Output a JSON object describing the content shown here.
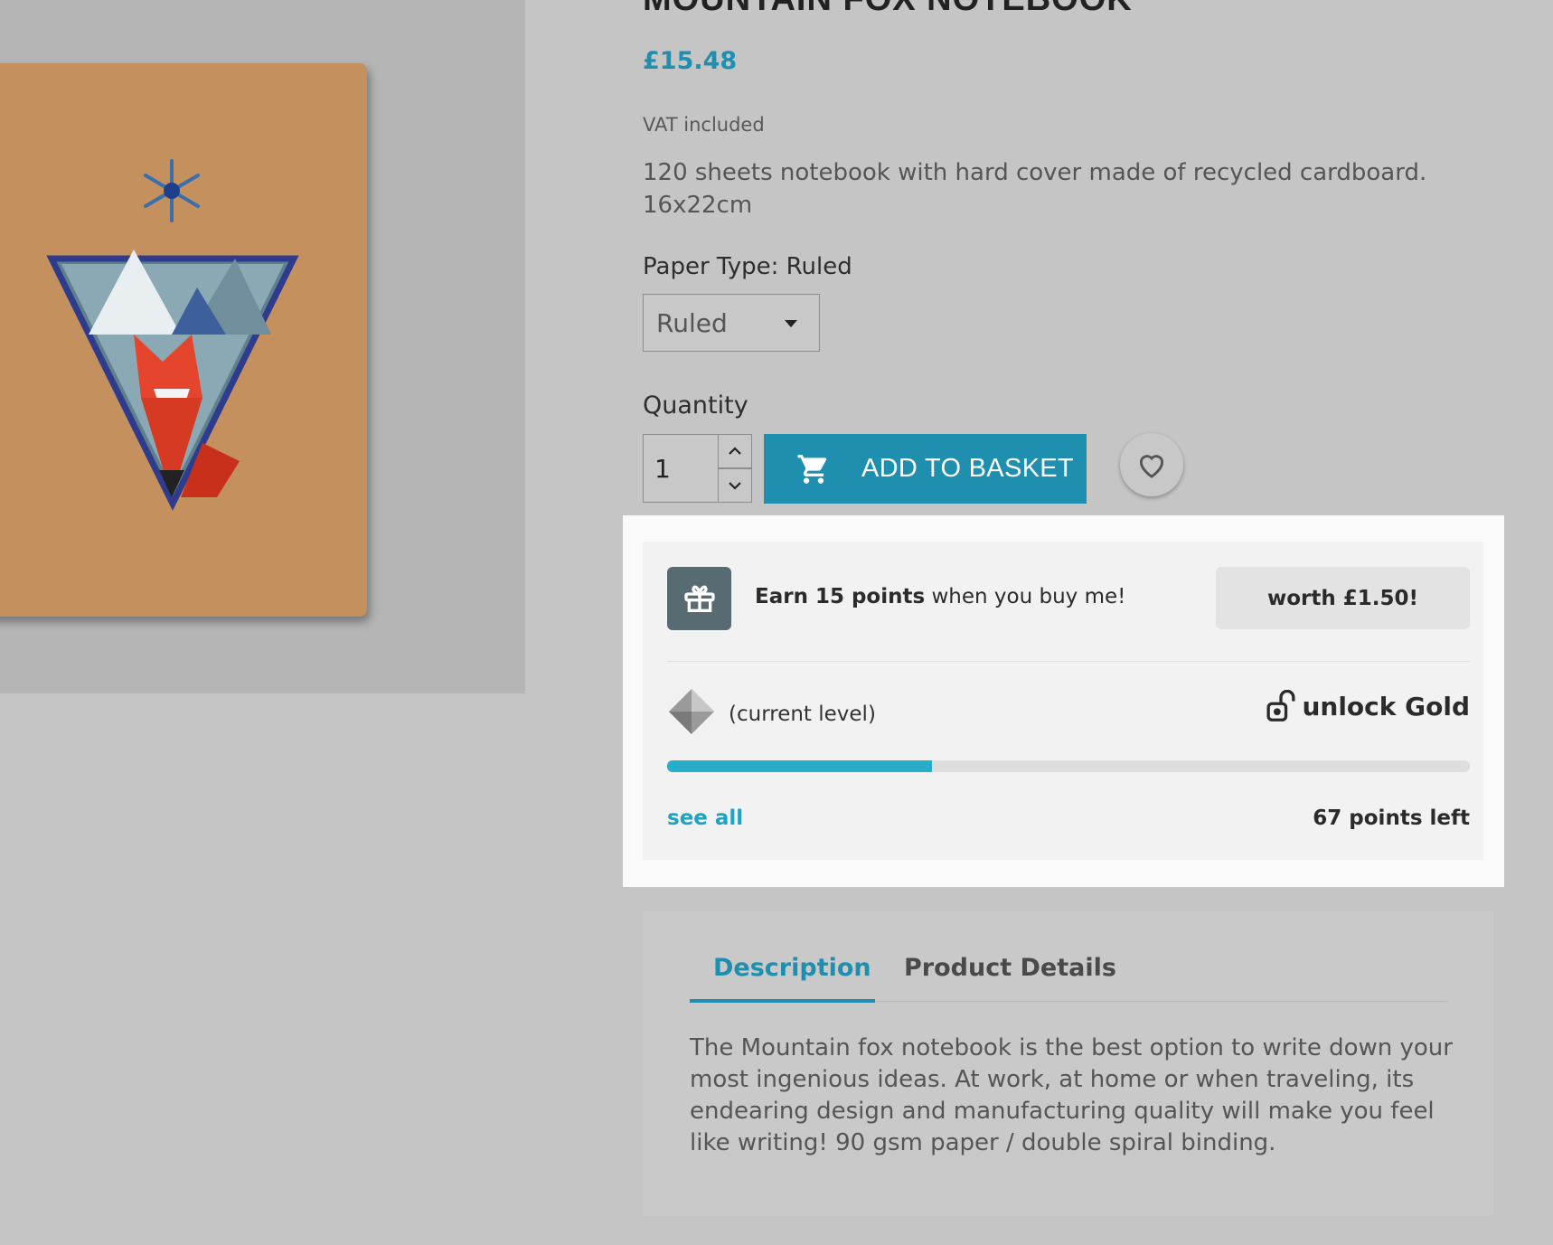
{
  "product": {
    "title": "MOUNTAIN FOX NOTEBOOK",
    "price": "£15.48",
    "tax_note": "VAT included",
    "summary": "120 sheets notebook with hard cover made of recycled cardboard. 16x22cm",
    "variant_label": "Paper Type: Ruled",
    "variant_selected": "Ruled",
    "quantity_label": "Quantity",
    "quantity_value": "1",
    "add_to_basket": "ADD TO BASKET"
  },
  "loyalty": {
    "earn_prefix": "Earn 15 points",
    "earn_suffix": " when you buy me!",
    "worth": "worth  £1.50!",
    "current_level": "(current level)",
    "unlock": "unlock Gold",
    "progress_fraction": 0.33,
    "see_all": "see all",
    "points_left": "67 points left",
    "accent_color": "#27aecb"
  },
  "tabs": {
    "items": [
      "Description",
      "Product Details"
    ],
    "active": "Description",
    "description_text": "The Mountain fox notebook is the best option to write down your most ingenious ideas. At work, at home or when traveling, its endearing design and manufacturing quality will make you feel like writing! 90 gsm paper / double spiral binding."
  },
  "icons": [
    "cart-icon",
    "heart-icon",
    "gift-icon",
    "diamond-level-icon",
    "unlock-icon",
    "chevron-up-icon",
    "chevron-down-icon",
    "caret-down-icon"
  ],
  "colors": {
    "brand": "#1f8fb0",
    "background": "#c5c5c5"
  }
}
